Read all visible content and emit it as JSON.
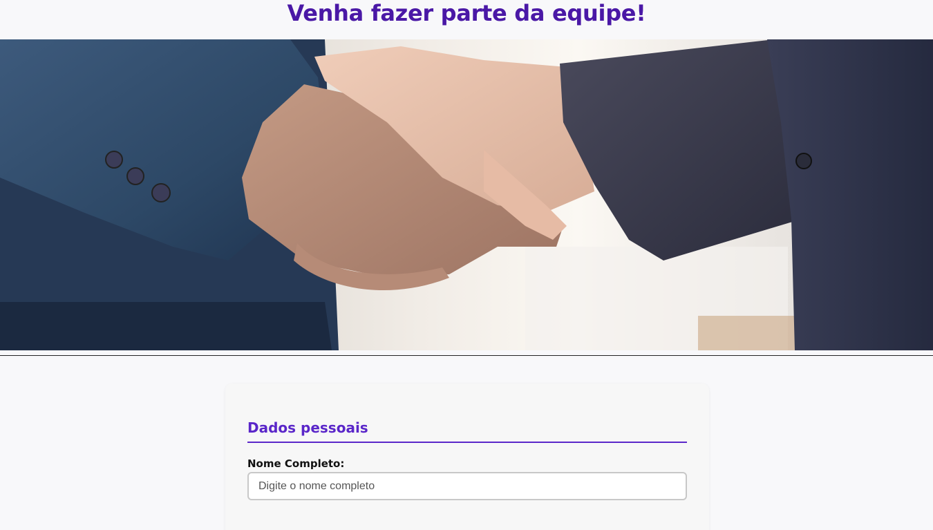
{
  "header": {
    "title": "Venha fazer parte da equipe!"
  },
  "hero": {
    "image_subject": "handshake-photo"
  },
  "form": {
    "section_title": "Dados pessoais",
    "fields": [
      {
        "label": "Nome Completo:",
        "placeholder": "Digite o nome completo",
        "value": ""
      }
    ]
  },
  "colors": {
    "title": "#4a18a6",
    "accent": "#5a26c9",
    "background": "#f8f8fa"
  }
}
